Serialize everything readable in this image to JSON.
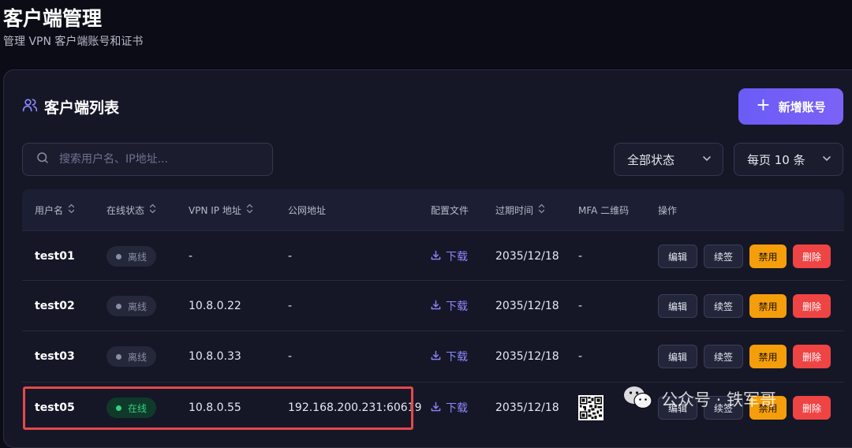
{
  "page": {
    "title": "客户端管理",
    "subtitle": "管理 VPN 客户端账号和证书"
  },
  "card": {
    "title": "客户端列表",
    "add_button": "新增账号"
  },
  "toolbar": {
    "search_placeholder": "搜索用户名、IP地址...",
    "status_filter": "全部状态",
    "page_size": "每页 10 条"
  },
  "table": {
    "columns": {
      "username": "用户名",
      "status": "在线状态",
      "vpn_ip": "VPN IP 地址",
      "public_ip": "公网地址",
      "config": "配置文件",
      "expiry": "过期时间",
      "mfa": "MFA 二维码",
      "actions": "操作"
    },
    "action_labels": {
      "edit": "编辑",
      "renew": "续签",
      "disable": "禁用",
      "delete": "删除"
    },
    "rows": [
      {
        "username": "test01",
        "status": "离线",
        "online": false,
        "vpn_ip": "-",
        "public_ip": "-",
        "config": "下载",
        "expiry": "2035/12/18",
        "mfa": "-"
      },
      {
        "username": "test02",
        "status": "离线",
        "online": false,
        "vpn_ip": "10.8.0.22",
        "public_ip": "-",
        "config": "下载",
        "expiry": "2035/12/18",
        "mfa": "-"
      },
      {
        "username": "test03",
        "status": "离线",
        "online": false,
        "vpn_ip": "10.8.0.33",
        "public_ip": "-",
        "config": "下载",
        "expiry": "2035/12/18",
        "mfa": "-"
      },
      {
        "username": "test05",
        "status": "在线",
        "online": true,
        "vpn_ip": "10.8.0.55",
        "public_ip": "192.168.200.231:60619",
        "config": "下载",
        "expiry": "2035/12/18",
        "mfa": "qr-code"
      }
    ]
  },
  "watermark": {
    "text": "公众号 · 铁军哥"
  },
  "colors": {
    "accent": "#6b5cf6",
    "online": "#34d17f",
    "offline": "#8a8da3",
    "disable": "#f59e0b",
    "delete": "#ef4444",
    "highlight": "#e5484d"
  }
}
